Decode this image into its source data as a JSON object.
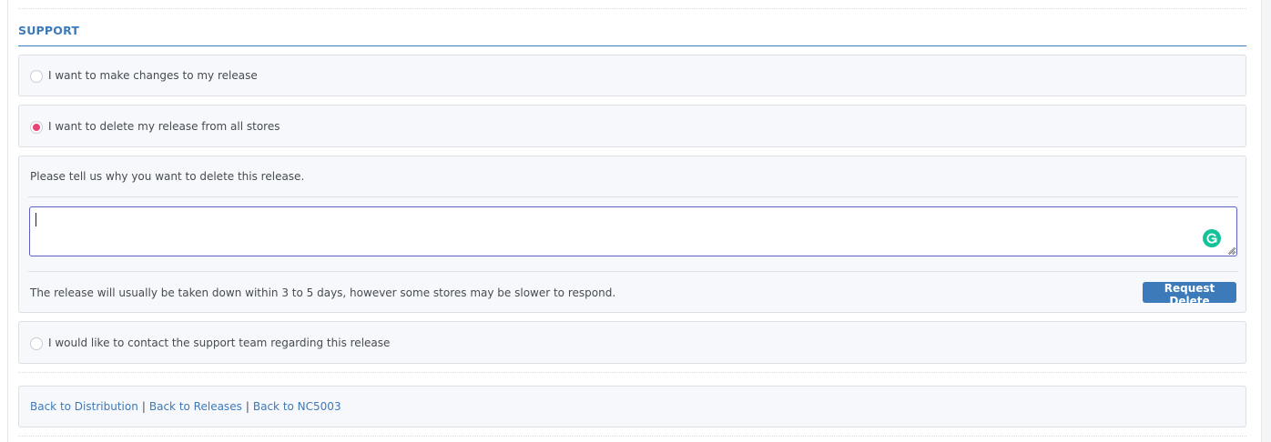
{
  "section": {
    "title": "SUPPORT"
  },
  "options": {
    "make_changes": {
      "label": "I want to make changes to my release",
      "checked": false
    },
    "delete_release": {
      "label": "I want to delete my release from all stores",
      "checked": true
    },
    "contact_support": {
      "label": "I would like to contact the support team regarding this release",
      "checked": false
    }
  },
  "delete_panel": {
    "prompt": "Please tell us why you want to delete this release.",
    "reason_value": "",
    "note": "The release will usually be taken down within 3 to 5 days, however some stores may be slower to respond.",
    "button_label": "Request Delete"
  },
  "nav": {
    "back_to_distribution": "Back to Distribution",
    "back_to_releases": "Back to Releases",
    "back_to_item": "Back to NC5003",
    "separator": "|"
  },
  "colors": {
    "accent": "#3c7ab9",
    "radio_checked": "#e8447a",
    "grammarly": "#15c39a",
    "textarea_focus_border": "#5b5fc7",
    "panel_background": "#f7f8fb"
  },
  "icons": {
    "grammarly": "grammarly-icon",
    "resize": "resize-handle-icon"
  }
}
